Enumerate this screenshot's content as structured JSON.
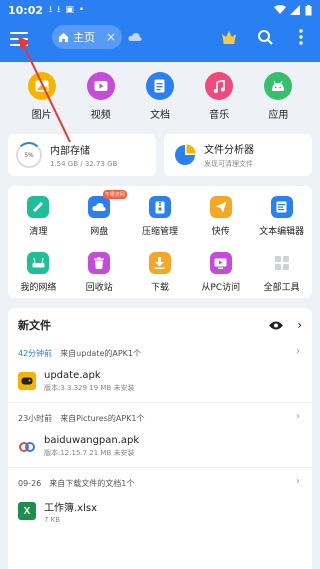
{
  "status": {
    "time": "10:02"
  },
  "header": {
    "tab_label": "主页",
    "tab_close": "×"
  },
  "categories": [
    {
      "label": "图片",
      "color": "#f5b400",
      "icon": "image-icon"
    },
    {
      "label": "视频",
      "color": "#c64bdb",
      "icon": "video-icon"
    },
    {
      "label": "文档",
      "color": "#2a7ff2",
      "icon": "document-icon"
    },
    {
      "label": "音乐",
      "color": "#f04a7a",
      "icon": "music-icon"
    },
    {
      "label": "应用",
      "color": "#36c06b",
      "icon": "android-icon"
    }
  ],
  "storage": {
    "title": "内部存储",
    "usage": "1.54 GB / 32.73 GB",
    "percent": "5%"
  },
  "analyzer": {
    "title": "文件分析器",
    "subtitle": "发现可清理文件"
  },
  "tools": [
    {
      "label": "清理",
      "color": "#1fbf9a",
      "icon": "broom-icon"
    },
    {
      "label": "网盘",
      "color": "#2a7ff2",
      "icon": "cloud-icon",
      "badge": "不限流网"
    },
    {
      "label": "压缩管理",
      "color": "#2a7ff2",
      "icon": "zip-icon"
    },
    {
      "label": "快传",
      "color": "#f5a623",
      "icon": "send-icon"
    },
    {
      "label": "文本编辑器",
      "color": "#2a7ff2",
      "icon": "text-editor-icon"
    },
    {
      "label": "我的网络",
      "color": "#1fbf9a",
      "icon": "router-icon"
    },
    {
      "label": "回收站",
      "color": "#c64bdb",
      "icon": "trash-icon"
    },
    {
      "label": "下载",
      "color": "#f5a623",
      "icon": "download-icon"
    },
    {
      "label": "从PC访问",
      "color": "#c64bdb",
      "icon": "pc-icon"
    },
    {
      "label": "全部工具",
      "color": "#cfd4da",
      "icon": "grid-icon"
    }
  ],
  "new_files": {
    "title": "新文件",
    "groups": [
      {
        "time": "42分钟前",
        "source": "来自update的APK1个",
        "file": "update.apk",
        "meta": "版本:3.3.329  19 MB  未安装",
        "icon": "gamepad-icon",
        "icon_color": "#f5b400"
      },
      {
        "time": "23小时前",
        "source": "来自Pictures的APK1个",
        "file": "baiduwangpan.apk",
        "meta": "版本:12.15.7  21 MB  未安装",
        "icon": "baidu-icon",
        "icon_color": "#ffffff"
      },
      {
        "time": "09-26",
        "source": "来自下载文件的文档1个",
        "file": "工作簿.xlsx",
        "meta": "7 KB",
        "icon": "excel-icon",
        "icon_color": "#1e8e4e"
      }
    ]
  }
}
